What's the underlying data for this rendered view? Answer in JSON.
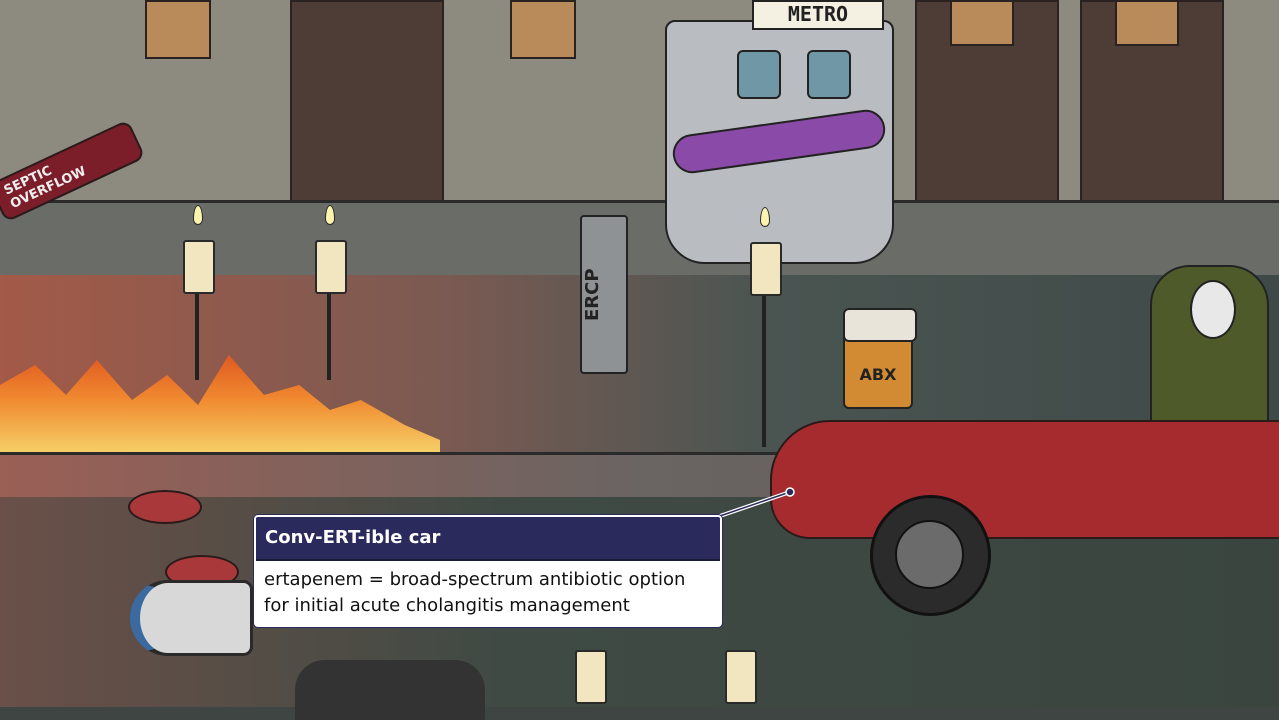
{
  "scene": {
    "metro_sign": "METRO",
    "pipe_label": "SEPTIC OVERFLOW",
    "ercp_label": "ERCP",
    "abx_label": "ABX"
  },
  "callout": {
    "title": "Conv-ERT-ible car",
    "body_line1": "ertapenem = broad-spectrum antibiotic option",
    "body_line2": "for initial acute cholangitis management",
    "header_color": "#2b2a5c"
  }
}
